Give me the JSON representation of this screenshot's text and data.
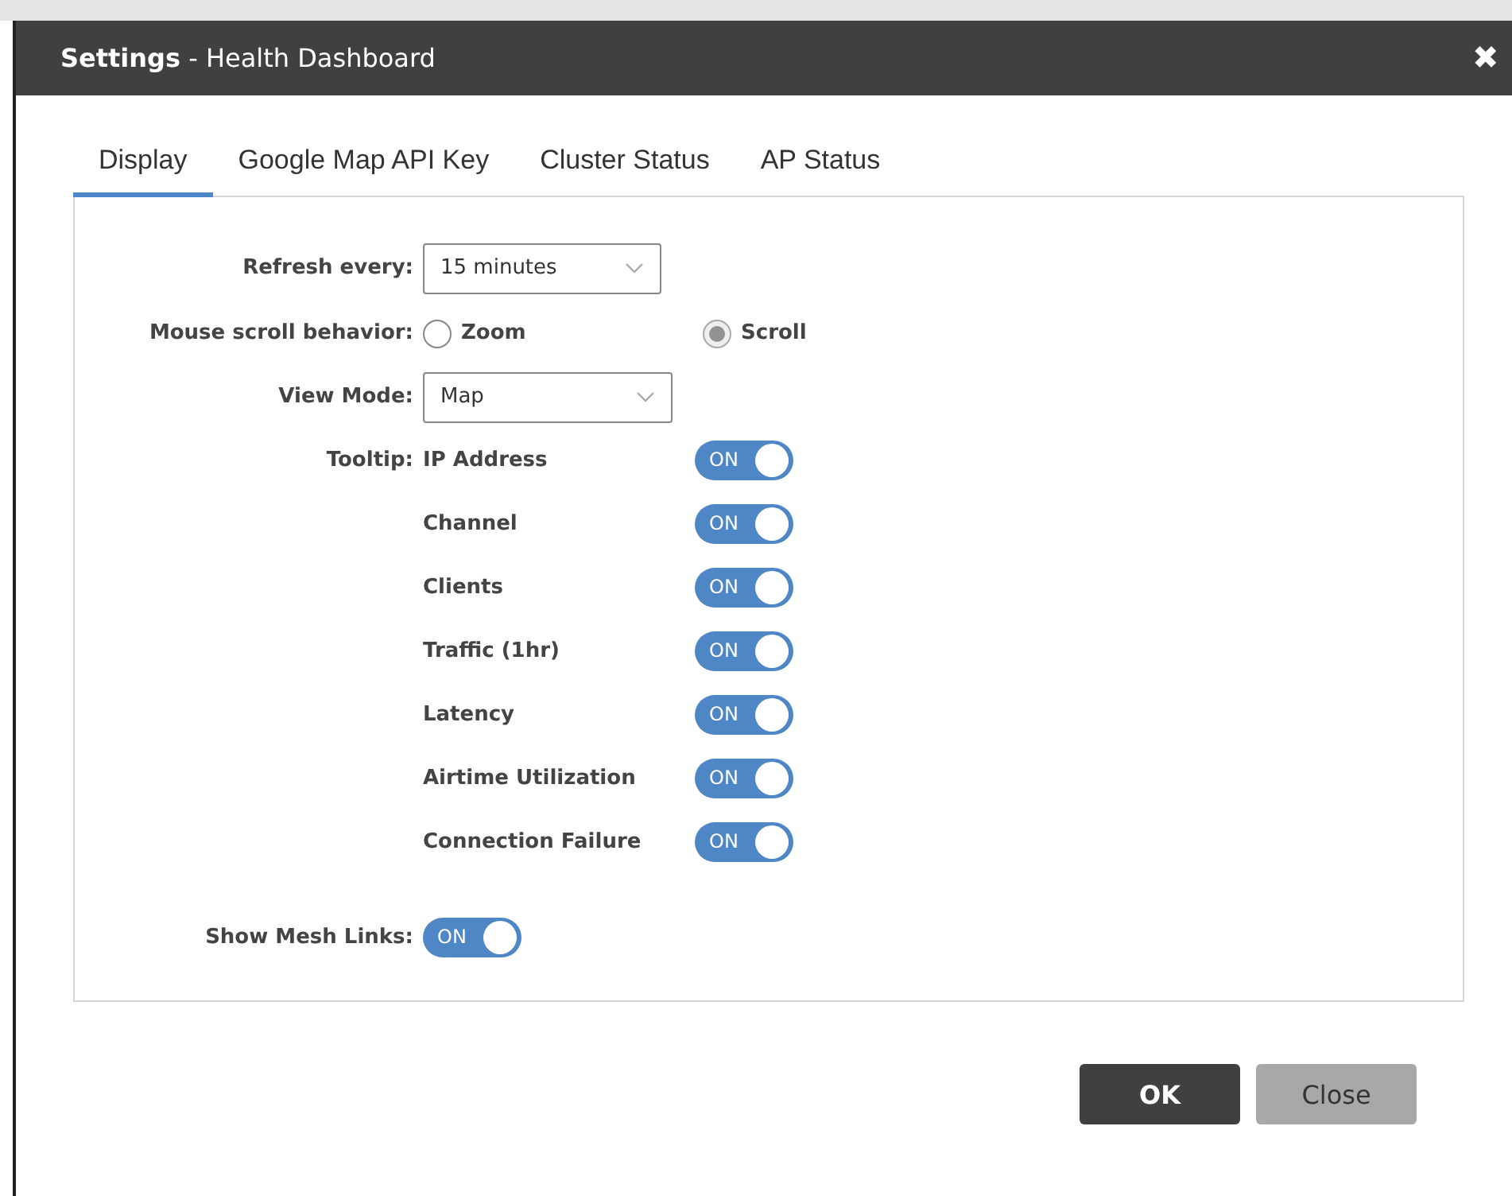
{
  "window": {
    "title_bold": "Settings",
    "title": " - Health Dashboard",
    "close": "✖"
  },
  "tabs": [
    {
      "label": "Display",
      "selected": true
    },
    {
      "label": "Google Map API Key",
      "selected": false
    },
    {
      "label": "Cluster Status",
      "selected": false
    },
    {
      "label": "AP Status",
      "selected": false
    }
  ],
  "refresh": {
    "label": "Refresh every:",
    "value": "15 minutes"
  },
  "scroll_behavior": {
    "label": "Mouse scroll behavior:",
    "options": [
      {
        "label": "Zoom",
        "selected": false
      },
      {
        "label": "Scroll",
        "selected": true
      }
    ]
  },
  "view_mode": {
    "label": "View Mode:",
    "value": "Map"
  },
  "tooltip": {
    "label": "Tooltip:",
    "items": [
      {
        "label": "IP Address",
        "on": true,
        "state": "ON"
      },
      {
        "label": "Channel",
        "on": true,
        "state": "ON"
      },
      {
        "label": "Clients",
        "on": true,
        "state": "ON"
      },
      {
        "label": "Traffic (1hr)",
        "on": true,
        "state": "ON"
      },
      {
        "label": "Latency",
        "on": true,
        "state": "ON"
      },
      {
        "label": "Airtime Utilization",
        "on": true,
        "state": "ON"
      },
      {
        "label": "Connection Failure",
        "on": true,
        "state": "ON"
      }
    ]
  },
  "mesh_links": {
    "label": "Show Mesh Links:",
    "on": true,
    "state": "ON"
  },
  "buttons": [
    {
      "label": "OK",
      "kind": "primary"
    },
    {
      "label": "Close",
      "kind": "secondary"
    }
  ]
}
